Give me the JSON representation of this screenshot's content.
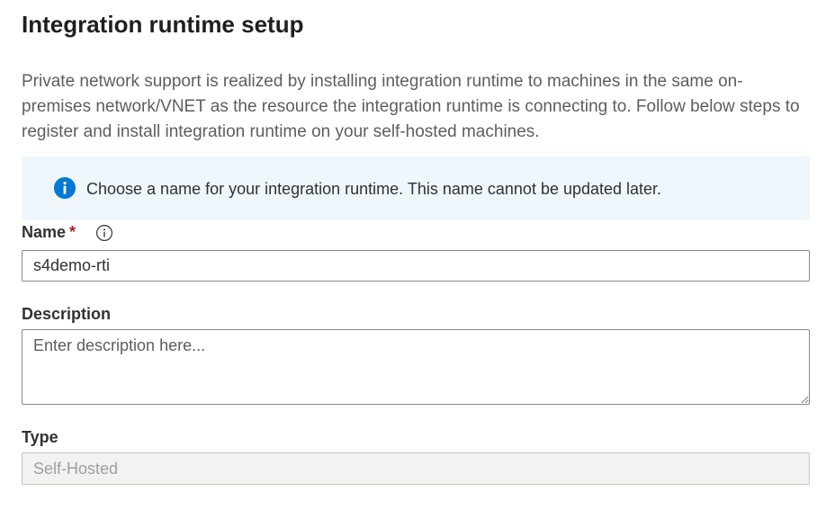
{
  "page": {
    "title": "Integration runtime setup",
    "intro": "Private network support is realized by installing integration runtime to machines in the same on-premises network/VNET as the resource the integration runtime is connecting to. Follow below steps to register and install integration runtime on your self-hosted machines."
  },
  "info_bar": {
    "icon": "info-icon",
    "message": "Choose a name for your integration runtime. This name cannot be updated later."
  },
  "fields": {
    "name": {
      "label": "Name",
      "required_marker": "*",
      "info_icon": "info-outline-icon",
      "value": "s4demo-rti"
    },
    "description": {
      "label": "Description",
      "placeholder": "Enter description here...",
      "value": ""
    },
    "type": {
      "label": "Type",
      "value": "Self-Hosted",
      "disabled": true
    }
  },
  "colors": {
    "info_bar_bg": "#eff6fc",
    "info_icon": "#0078d4",
    "required_star": "#a4262c"
  }
}
